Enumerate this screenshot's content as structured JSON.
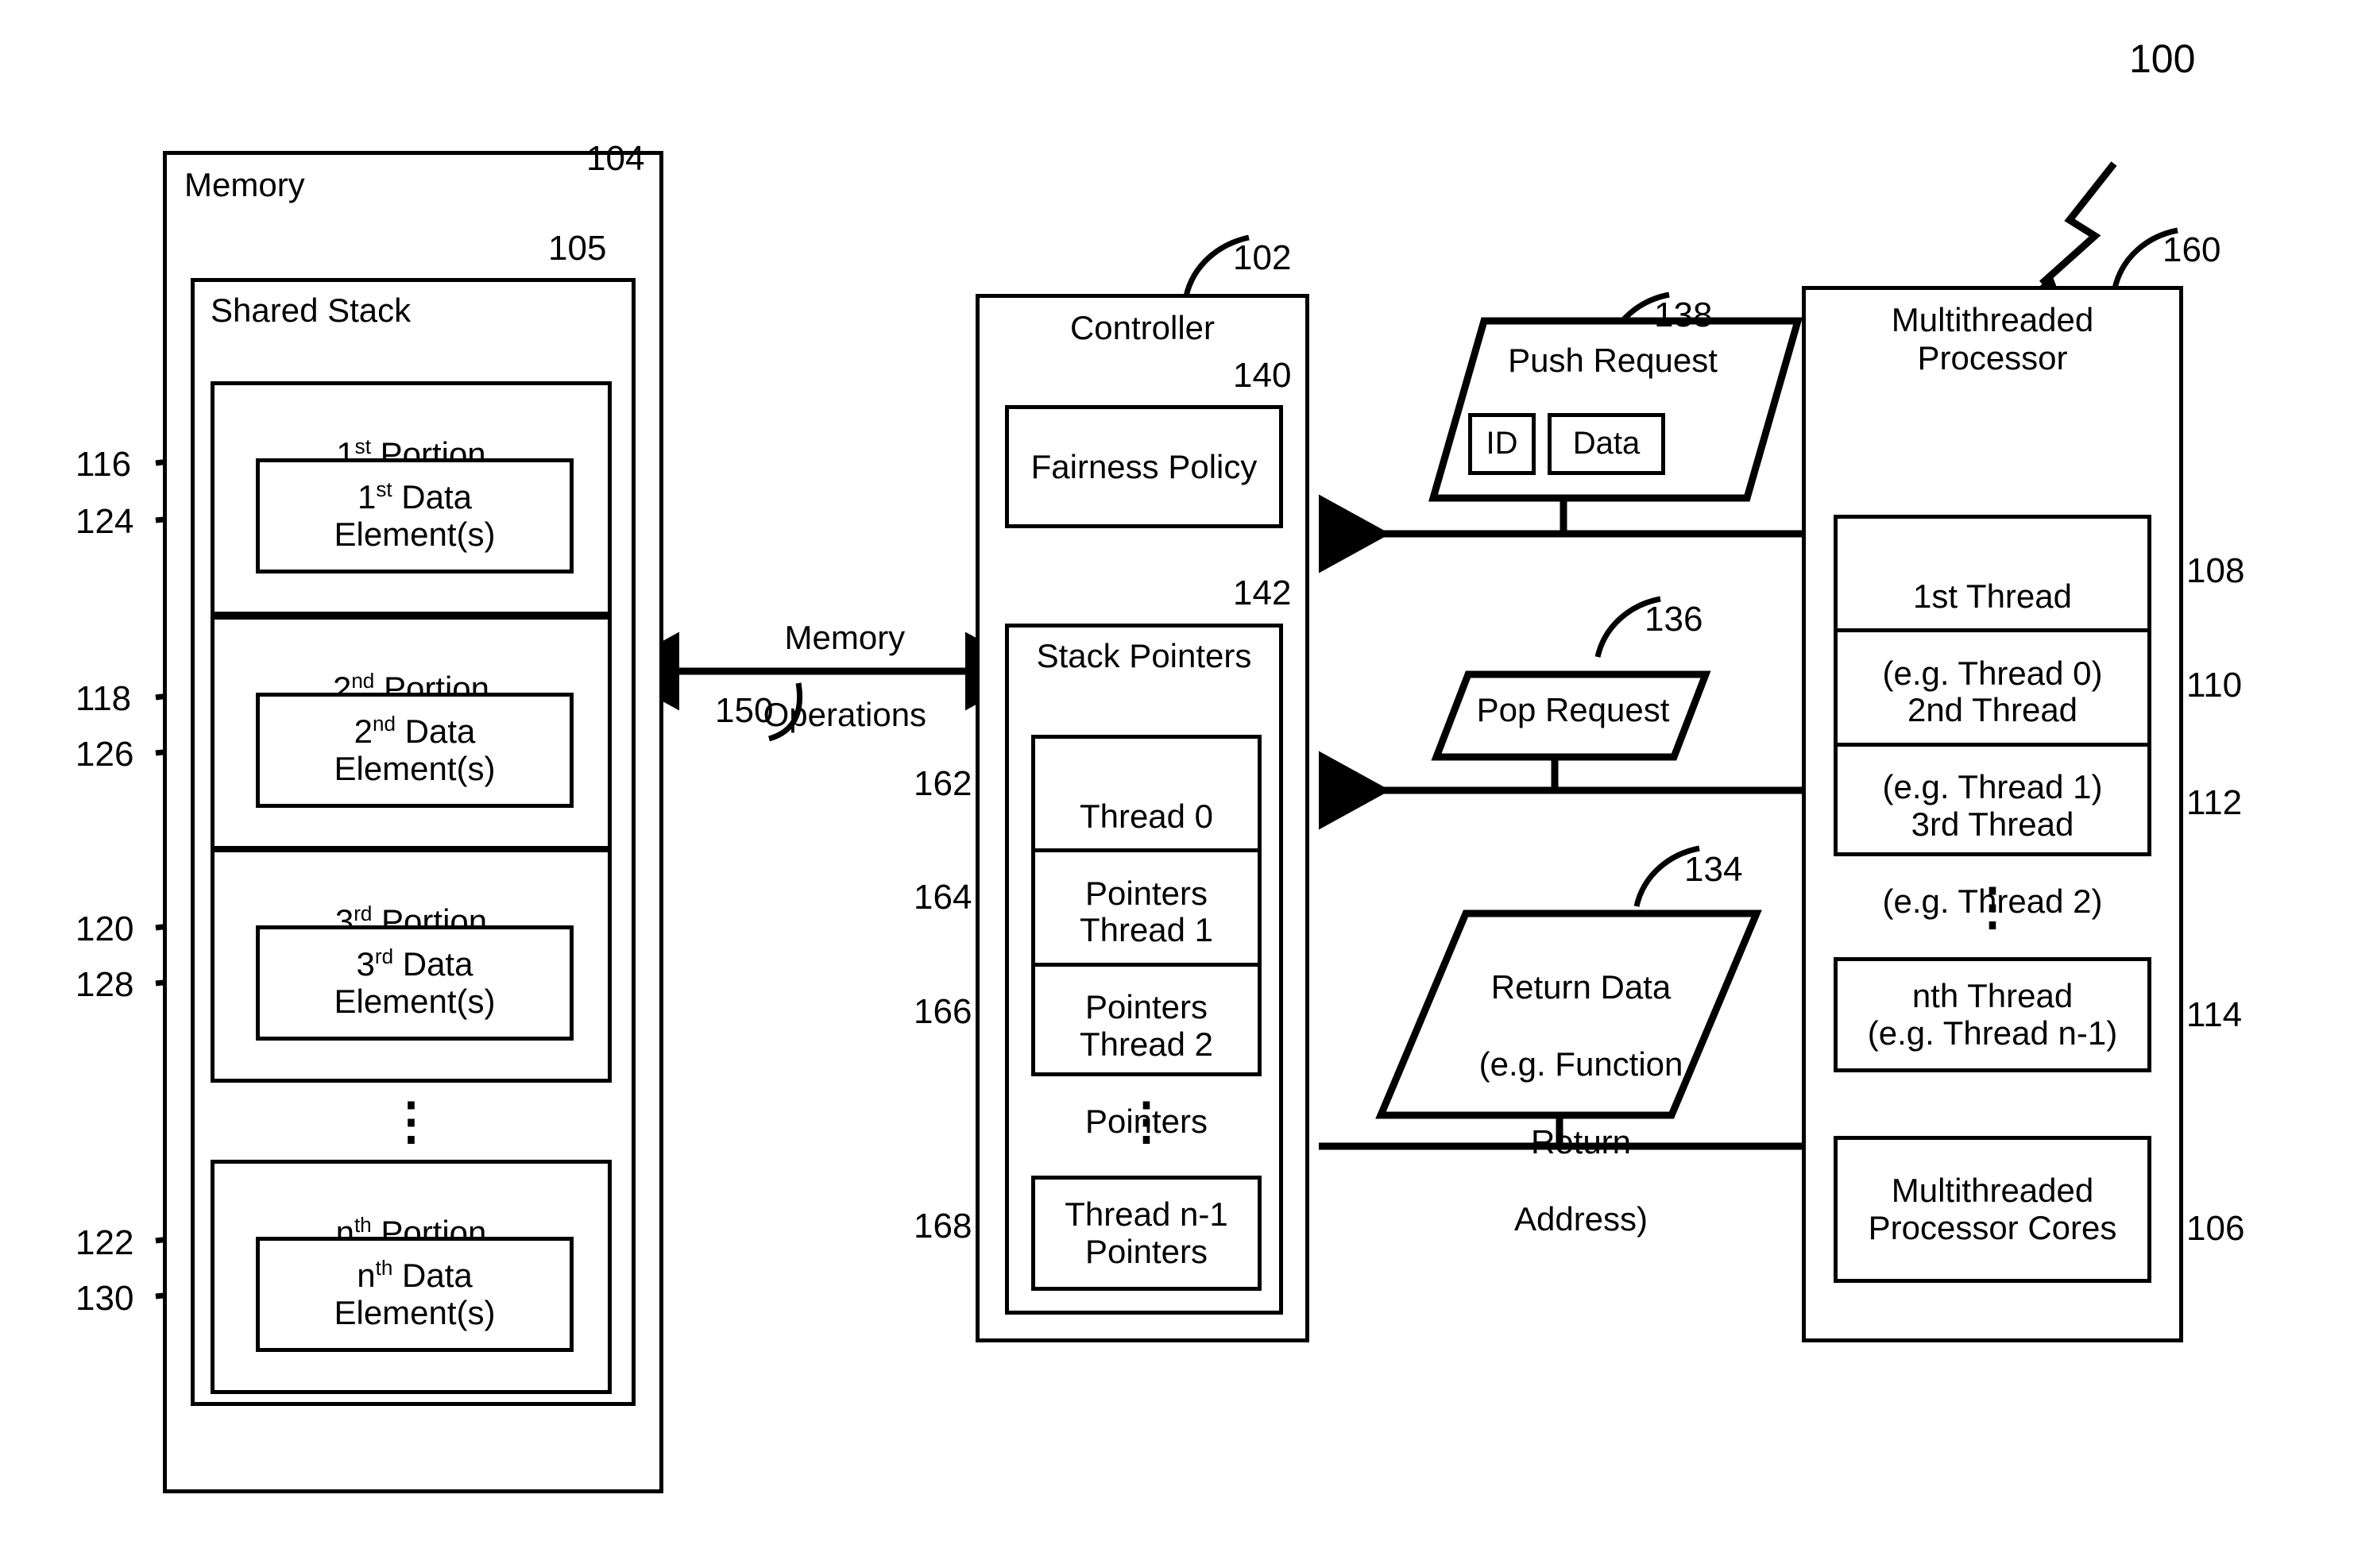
{
  "figure": {
    "ref_main": "100"
  },
  "memory": {
    "title": "Memory",
    "ref": "104",
    "shared_stack": {
      "title": "Shared Stack",
      "ref": "105",
      "ellipsis": "⋮",
      "portions": [
        {
          "label_base": "1",
          "label_sup": "st",
          "label_rest": " Portion",
          "ref": "116",
          "element_base": "1",
          "element_sup": "st",
          "element_rest": " Data",
          "element_line2": "Element(s)",
          "element_ref": "124"
        },
        {
          "label_base": "2",
          "label_sup": "nd",
          "label_rest": " Portion",
          "ref": "118",
          "element_base": "2",
          "element_sup": "nd",
          "element_rest": " Data",
          "element_line2": "Element(s)",
          "element_ref": "126"
        },
        {
          "label_base": "3",
          "label_sup": "rd",
          "label_rest": " Portion",
          "ref": "120",
          "element_base": "3",
          "element_sup": "rd",
          "element_rest": " Data",
          "element_line2": "Element(s)",
          "element_ref": "128"
        },
        {
          "label_base": "n",
          "label_sup": "th",
          "label_rest": " Portion",
          "ref": "122",
          "element_base": "n",
          "element_sup": "th",
          "element_rest": " Data",
          "element_line2": "Element(s)",
          "element_ref": "130"
        }
      ]
    }
  },
  "memory_operations": {
    "line1": "Memory",
    "line2": "Operations",
    "ref": "150"
  },
  "controller": {
    "title": "Controller",
    "ref": "102",
    "fairness_policy": {
      "label": "Fairness Policy",
      "ref": "140"
    },
    "stack_pointers": {
      "title": "Stack Pointers",
      "ref": "142",
      "ellipsis": "⋮",
      "items": [
        {
          "line1": "Thread 0",
          "line2": "Pointers",
          "ref": "162"
        },
        {
          "line1": "Thread 1",
          "line2": "Pointers",
          "ref": "164"
        },
        {
          "line1": "Thread 2",
          "line2": "Pointers",
          "ref": "166"
        },
        {
          "line1": "Thread n-1",
          "line2": "Pointers",
          "ref": "168"
        }
      ]
    }
  },
  "push_request": {
    "title": "Push Request",
    "ref": "138",
    "fields": [
      {
        "label": "ID"
      },
      {
        "label": "Data"
      }
    ]
  },
  "pop_request": {
    "title": "Pop Request",
    "ref": "136"
  },
  "return_data": {
    "line1": "Return Data",
    "line2": "(e.g. Function",
    "line3": "Return",
    "line4": "Address)",
    "ref": "134"
  },
  "processor": {
    "title_line1": "Multithreaded",
    "title_line2": "Processor",
    "ref": "160",
    "ellipsis": "⋮",
    "threads": [
      {
        "line1": "1st Thread",
        "line2": "(e.g. Thread 0)",
        "ref": "108"
      },
      {
        "line1": "2nd Thread",
        "line2": "(e.g. Thread 1)",
        "ref": "110"
      },
      {
        "line1": "3rd Thread",
        "line2": "(e.g. Thread 2)",
        "ref": "112"
      },
      {
        "line1": "nth Thread",
        "line2": "(e.g. Thread n-1)",
        "ref": "114"
      }
    ],
    "cores": {
      "line1": "Multithreaded",
      "line2": "Processor Cores",
      "ref": "106"
    }
  }
}
